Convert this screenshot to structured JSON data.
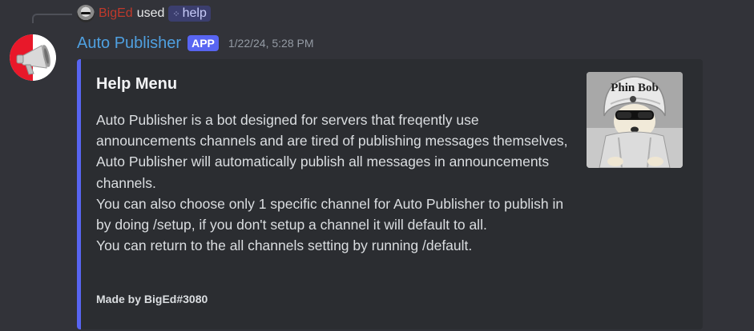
{
  "reply": {
    "user": "BigEd",
    "used": "used",
    "command": "help"
  },
  "message": {
    "bot_name": "Auto Publisher",
    "badge": "APP",
    "timestamp": "1/22/24, 5:28 PM"
  },
  "embed": {
    "title": "Help Menu",
    "description": [
      "Auto Publisher is a bot designed for servers that freqently use announcements channels and are tired of publishing messages themselves, Auto Publisher will automatically publish all messages in announcements channels.",
      "You can also choose only 1 specific channel for Auto Publisher to publish in by doing /setup, if you don't setup a channel it will default to all.",
      "You can return to the all channels setting by running /default."
    ],
    "footer": "Made by BigEd#3080",
    "thumbnail_caption": "Phin Bob",
    "accent_color": "#5865f2"
  },
  "icons": {
    "bot_avatar": "megaphone-icon",
    "command": "slash-command-icon"
  }
}
